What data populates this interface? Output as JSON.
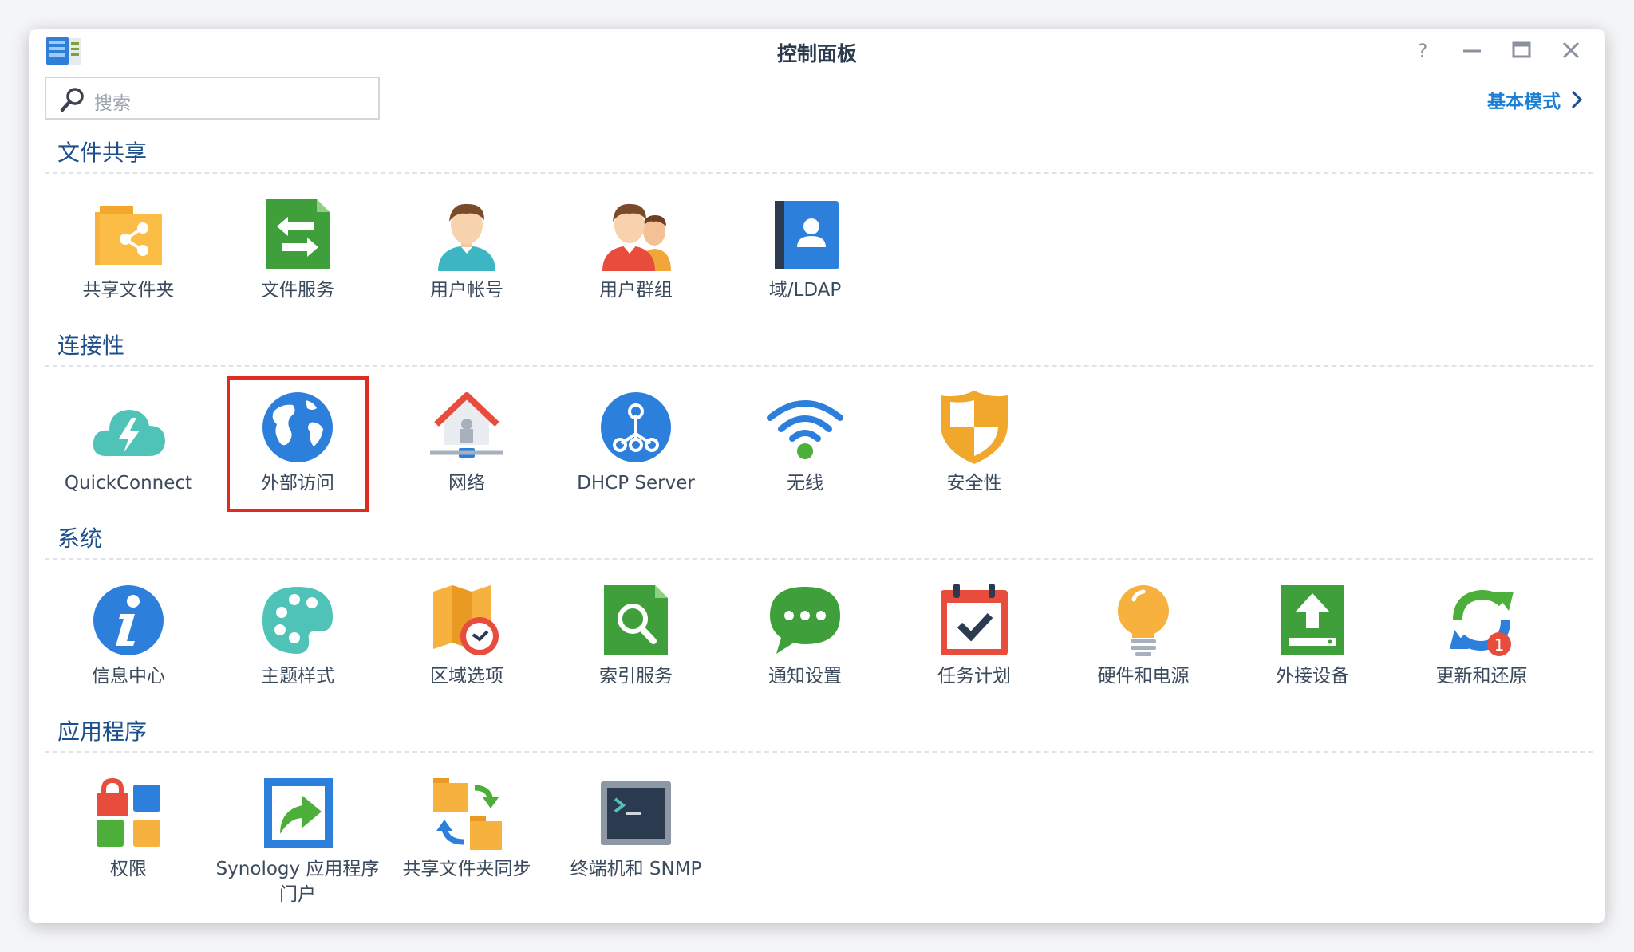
{
  "window": {
    "title": "控制面板"
  },
  "search": {
    "placeholder": "搜索"
  },
  "header": {
    "basic_mode": "基本模式"
  },
  "sections": [
    {
      "title": "文件共享",
      "items": [
        {
          "label": "共享文件夹",
          "icon": "shared-folder-icon"
        },
        {
          "label": "文件服务",
          "icon": "file-services-icon"
        },
        {
          "label": "用户帐号",
          "icon": "user-icon"
        },
        {
          "label": "用户群组",
          "icon": "group-icon"
        },
        {
          "label": "域/LDAP",
          "icon": "ldap-icon"
        }
      ]
    },
    {
      "title": "连接性",
      "items": [
        {
          "label": "QuickConnect",
          "icon": "quickconnect-icon"
        },
        {
          "label": "外部访问",
          "icon": "globe-icon",
          "highlighted": true
        },
        {
          "label": "网络",
          "icon": "network-house-icon"
        },
        {
          "label": "DHCP Server",
          "icon": "dhcp-icon"
        },
        {
          "label": "无线",
          "icon": "wifi-icon"
        },
        {
          "label": "安全性",
          "icon": "shield-icon"
        }
      ]
    },
    {
      "title": "系统",
      "items": [
        {
          "label": "信息中心",
          "icon": "info-icon"
        },
        {
          "label": "主题样式",
          "icon": "palette-icon"
        },
        {
          "label": "区域选项",
          "icon": "regional-map-clock-icon"
        },
        {
          "label": "索引服务",
          "icon": "index-search-icon"
        },
        {
          "label": "通知设置",
          "icon": "chat-bubble-icon"
        },
        {
          "label": "任务计划",
          "icon": "calendar-check-icon"
        },
        {
          "label": "硬件和电源",
          "icon": "lightbulb-icon"
        },
        {
          "label": "外接设备",
          "icon": "upload-icon"
        },
        {
          "label": "更新和还原",
          "icon": "update-icon",
          "badge": "1"
        }
      ]
    },
    {
      "title": "应用程序",
      "items": [
        {
          "label": "权限",
          "icon": "privileges-icon"
        },
        {
          "label": "Synology 应用程序门户",
          "icon": "app-portal-icon"
        },
        {
          "label": "共享文件夹同步",
          "icon": "folder-sync-icon"
        },
        {
          "label": "终端机和 SNMP",
          "icon": "terminal-icon"
        }
      ]
    }
  ],
  "colors": {
    "accent": "#1b7fd3",
    "highlight": "#e02b20",
    "section_title": "#1d4f8a"
  }
}
